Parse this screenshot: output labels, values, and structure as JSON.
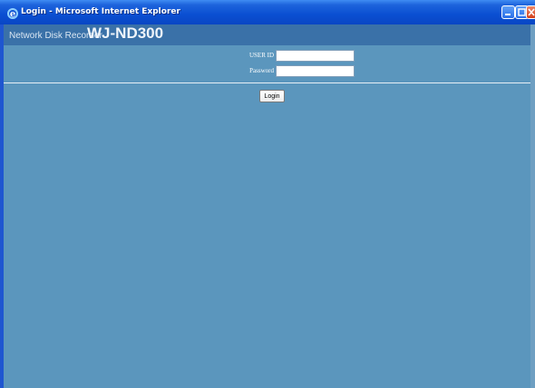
{
  "window": {
    "title": "Login - Microsoft Internet Explorer",
    "buttons": [
      "minimize",
      "maximize",
      "close"
    ]
  },
  "header": {
    "product_line": "Network Disk Recorder",
    "model": "WJ-ND300"
  },
  "form": {
    "user_id_label": "USER ID",
    "password_label": "Password",
    "user_id_value": "",
    "password_value": "",
    "login_label": "Login"
  },
  "icons": {
    "ie": "ie-logo-icon",
    "minimize": "minimize-icon",
    "maximize": "maximize-icon",
    "close": "close-icon"
  },
  "colors": {
    "titlebar": "#0a4fd2",
    "header": "#3a71a8",
    "background": "#5b96bd"
  }
}
